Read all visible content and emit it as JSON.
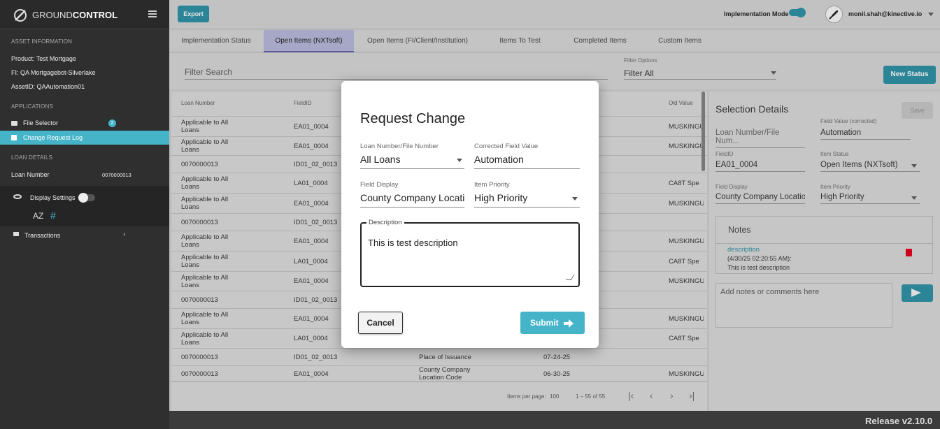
{
  "app": {
    "logo_text_a": "GROUND",
    "logo_text_b": "CONTROL",
    "release": "Release v2.10.0"
  },
  "sidebar": {
    "asset_header": "ASSET INFORMATION",
    "product_label": "Product:",
    "product_value": "Test Mortgage",
    "fi_label": "FI:",
    "fi_value": "QA Mortgagebot-Silverlake",
    "asset_label": "AssetID:",
    "asset_value": "QAAutomation01",
    "applications_header": "APPLICATIONS",
    "file_selector": "File Selector",
    "file_selector_badge": "2",
    "change_request_log": "Change Request Log",
    "loan_details_header": "LOAN DETAILS",
    "loan_number_label": "Loan Number",
    "loan_number_value": "0070000013",
    "display_settings": "Display Settings",
    "sort_az": "AZ",
    "hash": "#",
    "transactions": "Transactions"
  },
  "topbar": {
    "export": "Export",
    "impl_mode": "Implementation Mode",
    "user_email": "monil.shah@kinective.io"
  },
  "tabs": [
    "Implementation Status",
    "Open Items (NXTsoft)",
    "Open Items (FI/Client/Institution)",
    "Items To Test",
    "Completed Items",
    "Custom Items"
  ],
  "filter": {
    "search_placeholder": "Filter Search",
    "options_label": "Filter Options",
    "options_value": "Filter All",
    "new_status": "New Status"
  },
  "table": {
    "headers": {
      "loan": "Loan Number",
      "field": "FieldID",
      "old": "Old Value"
    },
    "rows": [
      {
        "loan": "Applicable to All Loans",
        "field": "EA01_0004",
        "display": "",
        "newv": "",
        "old": "MUSKINGU"
      },
      {
        "loan": "Applicable to All Loans",
        "field": "EA01_0004",
        "display": "",
        "newv": "",
        "old": "MUSKINGU"
      },
      {
        "loan": "0070000013",
        "field": "ID01_02_0013",
        "display": "",
        "newv": "",
        "old": ""
      },
      {
        "loan": "Applicable to All Loans",
        "field": "LA01_0004",
        "display": "",
        "newv": "",
        "old": "CA8T Spe"
      },
      {
        "loan": "Applicable to All Loans",
        "field": "EA01_0004",
        "display": "",
        "newv": "",
        "old": "MUSKINGU"
      },
      {
        "loan": "0070000013",
        "field": "ID01_02_0013",
        "display": "",
        "newv": "",
        "old": ""
      },
      {
        "loan": "Applicable to All Loans",
        "field": "EA01_0004",
        "display": "",
        "newv": "",
        "old": "MUSKINGU"
      },
      {
        "loan": "Applicable to All Loans",
        "field": "LA01_0004",
        "display": "",
        "newv": "",
        "old": "CA8T Spe"
      },
      {
        "loan": "Applicable to All Loans",
        "field": "EA01_0004",
        "display": "",
        "newv": "",
        "old": "MUSKINGU"
      },
      {
        "loan": "0070000013",
        "field": "ID01_02_0013",
        "display": "",
        "newv": "",
        "old": ""
      },
      {
        "loan": "Applicable to All Loans",
        "field": "EA01_0004",
        "display": "",
        "newv": "",
        "old": "MUSKINGU"
      },
      {
        "loan": "Applicable to All Loans",
        "field": "LA01_0004",
        "display": "",
        "newv": "",
        "old": "CA8T Spe"
      },
      {
        "loan": "0070000013",
        "field": "ID01_02_0013",
        "display": "Place of Issuance",
        "newv": "07-24-25",
        "old": ""
      },
      {
        "loan": "0070000013",
        "field": "EA01_0004",
        "display": "County Company Location Code",
        "newv": "06-30-25",
        "old": "MUSKINGU"
      }
    ],
    "paginator": {
      "per_page_label": "Items per page:",
      "per_page": "100",
      "range": "1 – 55 of 55"
    }
  },
  "details": {
    "title": "Selection Details",
    "save": "Save",
    "loan_placeholder": "Loan Number/File Num...",
    "field_value_label": "Field Value (corrected)",
    "field_value": "Automation",
    "fieldid_label": "FieldID",
    "fieldid": "EA01_0004",
    "item_status_label": "Item Status",
    "item_status": "Open Items (NXTsoft)",
    "field_display_label": "Field Display",
    "field_display": "County Company Locatio",
    "priority_label": "Item Priority",
    "priority": "High Priority",
    "notes_title": "Notes",
    "note_link": "description",
    "note_time": "(4/30/25 02:20:55 AM):",
    "note_text": "This is test description",
    "comment_placeholder": "Add notes or comments here"
  },
  "modal": {
    "title": "Request Change",
    "loan_label": "Loan Number/File Number",
    "loan_value": "All Loans",
    "corrected_label": "Corrected Field Value",
    "corrected_value": "Automation",
    "display_label": "Field Display",
    "display_value": "County Company Locatio",
    "priority_label": "Item Priority",
    "priority_value": "High Priority",
    "description_label": "Description",
    "description_value": "This is test description",
    "cancel": "Cancel",
    "submit": "Submit"
  },
  "colors": {
    "teal": "#45b4c9",
    "active_tab": "#a7a7c7",
    "delete_red": "#d0021b"
  }
}
